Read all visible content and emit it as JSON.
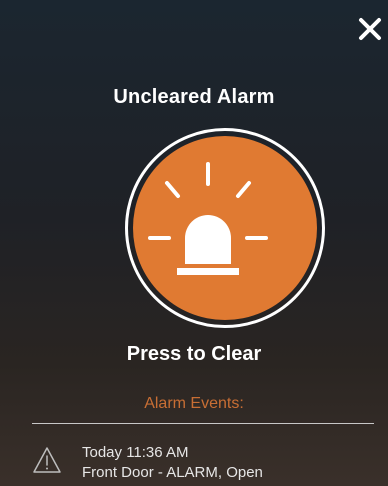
{
  "dialog": {
    "close_icon": "close-icon",
    "title": "Uncleared Alarm",
    "alarm_button": {
      "icon": "siren-icon",
      "color": "#e07a32",
      "ring_color": "#ffffff"
    },
    "press_label": "Press to Clear",
    "events_header": "Alarm Events:",
    "events_header_color": "#c86e34",
    "events": [
      {
        "icon": "warning-icon",
        "time": "Today 11:36 AM",
        "description": "Front Door - ALARM, Open"
      }
    ]
  }
}
